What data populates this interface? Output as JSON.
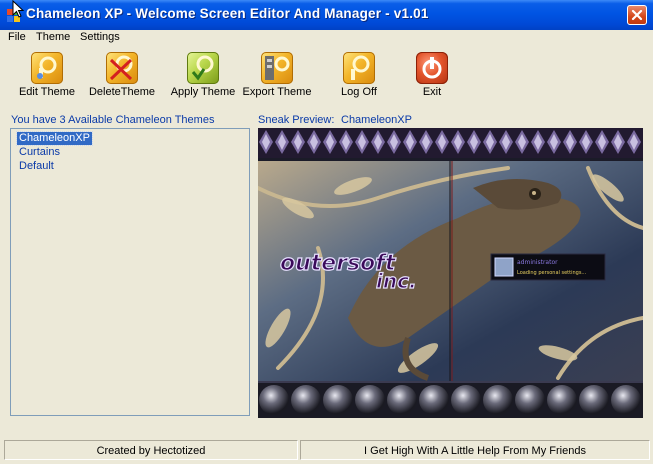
{
  "window": {
    "title": "Chameleon XP - Welcome Screen Editor And Manager - v1.01"
  },
  "menu": [
    "File",
    "Theme",
    "Settings"
  ],
  "toolbar": {
    "buttons": [
      {
        "label": "Edit Theme",
        "icon": "edit-theme-icon"
      },
      {
        "label": "DeleteTheme",
        "icon": "delete-theme-icon"
      },
      {
        "label": "Apply Theme",
        "icon": "apply-theme-icon"
      },
      {
        "label": "Export Theme",
        "icon": "export-theme-icon"
      },
      {
        "label": "Log Off",
        "icon": "log-off-icon"
      },
      {
        "label": "Exit",
        "icon": "exit-icon"
      }
    ]
  },
  "themes": {
    "header": "You have 3 Available Chameleon Themes",
    "items": [
      "ChameleonXP",
      "Curtains",
      "Default"
    ],
    "selected": "ChameleonXP"
  },
  "preview": {
    "label": "Sneak Preview:",
    "theme_name": "ChameleonXP",
    "logo_line1": "outersoft",
    "logo_line2": "inc.",
    "user_name": "administrator",
    "user_status": "Loading personal settings..."
  },
  "status": {
    "left": "Created by Hectotized",
    "right": "I Get High With A Little Help From My Friends"
  },
  "colors": {
    "titlebar": "#0054e3",
    "accent_text": "#0a3aa8",
    "selection": "#316ac5",
    "close": "#d44619"
  }
}
